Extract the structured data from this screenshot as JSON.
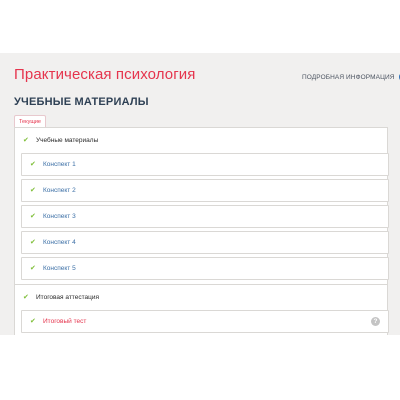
{
  "course": {
    "title": "Практическая психология",
    "info_link": "Подробная информация",
    "info_icon": "info-circle-icon"
  },
  "materials": {
    "section_title": "УЧЕБНЫЕ МАТЕРИАЛЫ",
    "tab_label": "Текущие"
  },
  "modules": [
    {
      "title": "Учебные материалы",
      "lessons": [
        "Конспект 1",
        "Конспект 2",
        "Конспект 3",
        "Конспект 4",
        "Конспект 5"
      ]
    },
    {
      "title": "Итоговая аттестация",
      "lessons": [
        "Итоговый тест"
      ]
    }
  ],
  "icons": {
    "check": "check-icon",
    "help": "question-circle-icon"
  },
  "colors": {
    "accent": "#e5344d",
    "check": "#7fbf3a",
    "link": "#3a6ea5",
    "heading": "#2f4155"
  }
}
